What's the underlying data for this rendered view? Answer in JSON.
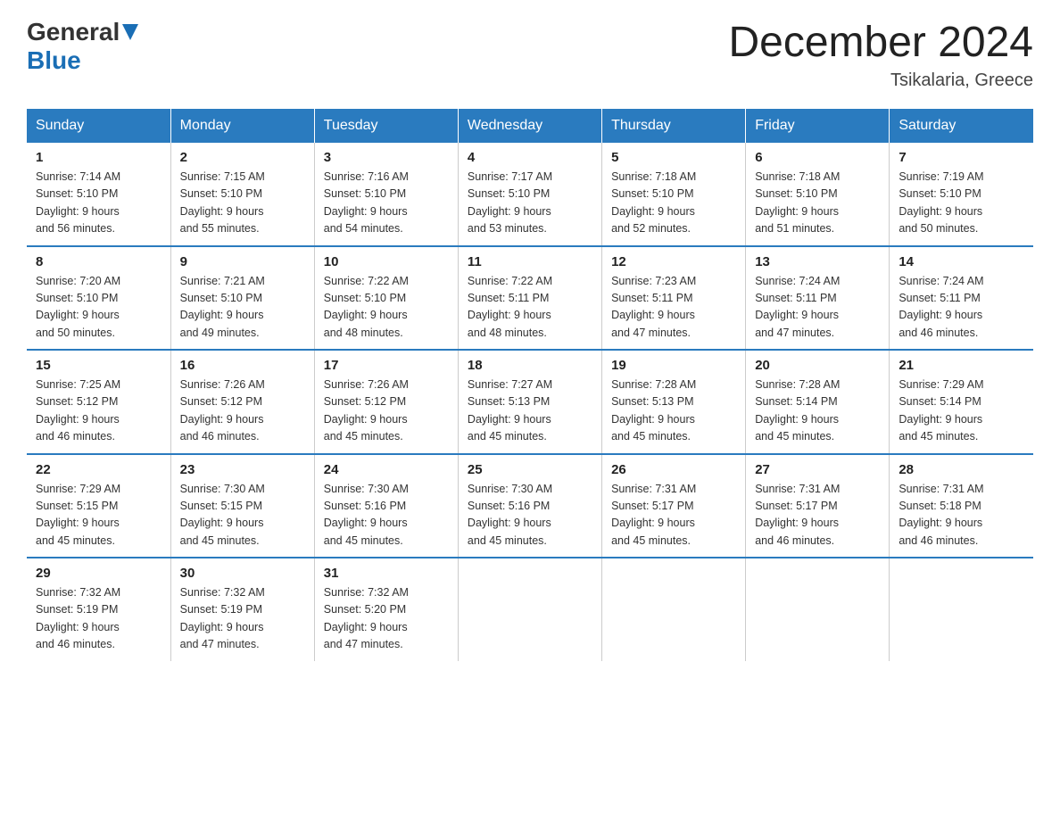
{
  "header": {
    "logo_general": "General",
    "logo_blue": "Blue",
    "month_title": "December 2024",
    "location": "Tsikalaria, Greece"
  },
  "columns": [
    "Sunday",
    "Monday",
    "Tuesday",
    "Wednesday",
    "Thursday",
    "Friday",
    "Saturday"
  ],
  "weeks": [
    [
      {
        "day": "1",
        "sunrise": "7:14 AM",
        "sunset": "5:10 PM",
        "daylight": "9 hours and 56 minutes."
      },
      {
        "day": "2",
        "sunrise": "7:15 AM",
        "sunset": "5:10 PM",
        "daylight": "9 hours and 55 minutes."
      },
      {
        "day": "3",
        "sunrise": "7:16 AM",
        "sunset": "5:10 PM",
        "daylight": "9 hours and 54 minutes."
      },
      {
        "day": "4",
        "sunrise": "7:17 AM",
        "sunset": "5:10 PM",
        "daylight": "9 hours and 53 minutes."
      },
      {
        "day": "5",
        "sunrise": "7:18 AM",
        "sunset": "5:10 PM",
        "daylight": "9 hours and 52 minutes."
      },
      {
        "day": "6",
        "sunrise": "7:18 AM",
        "sunset": "5:10 PM",
        "daylight": "9 hours and 51 minutes."
      },
      {
        "day": "7",
        "sunrise": "7:19 AM",
        "sunset": "5:10 PM",
        "daylight": "9 hours and 50 minutes."
      }
    ],
    [
      {
        "day": "8",
        "sunrise": "7:20 AM",
        "sunset": "5:10 PM",
        "daylight": "9 hours and 50 minutes."
      },
      {
        "day": "9",
        "sunrise": "7:21 AM",
        "sunset": "5:10 PM",
        "daylight": "9 hours and 49 minutes."
      },
      {
        "day": "10",
        "sunrise": "7:22 AM",
        "sunset": "5:10 PM",
        "daylight": "9 hours and 48 minutes."
      },
      {
        "day": "11",
        "sunrise": "7:22 AM",
        "sunset": "5:11 PM",
        "daylight": "9 hours and 48 minutes."
      },
      {
        "day": "12",
        "sunrise": "7:23 AM",
        "sunset": "5:11 PM",
        "daylight": "9 hours and 47 minutes."
      },
      {
        "day": "13",
        "sunrise": "7:24 AM",
        "sunset": "5:11 PM",
        "daylight": "9 hours and 47 minutes."
      },
      {
        "day": "14",
        "sunrise": "7:24 AM",
        "sunset": "5:11 PM",
        "daylight": "9 hours and 46 minutes."
      }
    ],
    [
      {
        "day": "15",
        "sunrise": "7:25 AM",
        "sunset": "5:12 PM",
        "daylight": "9 hours and 46 minutes."
      },
      {
        "day": "16",
        "sunrise": "7:26 AM",
        "sunset": "5:12 PM",
        "daylight": "9 hours and 46 minutes."
      },
      {
        "day": "17",
        "sunrise": "7:26 AM",
        "sunset": "5:12 PM",
        "daylight": "9 hours and 45 minutes."
      },
      {
        "day": "18",
        "sunrise": "7:27 AM",
        "sunset": "5:13 PM",
        "daylight": "9 hours and 45 minutes."
      },
      {
        "day": "19",
        "sunrise": "7:28 AM",
        "sunset": "5:13 PM",
        "daylight": "9 hours and 45 minutes."
      },
      {
        "day": "20",
        "sunrise": "7:28 AM",
        "sunset": "5:14 PM",
        "daylight": "9 hours and 45 minutes."
      },
      {
        "day": "21",
        "sunrise": "7:29 AM",
        "sunset": "5:14 PM",
        "daylight": "9 hours and 45 minutes."
      }
    ],
    [
      {
        "day": "22",
        "sunrise": "7:29 AM",
        "sunset": "5:15 PM",
        "daylight": "9 hours and 45 minutes."
      },
      {
        "day": "23",
        "sunrise": "7:30 AM",
        "sunset": "5:15 PM",
        "daylight": "9 hours and 45 minutes."
      },
      {
        "day": "24",
        "sunrise": "7:30 AM",
        "sunset": "5:16 PM",
        "daylight": "9 hours and 45 minutes."
      },
      {
        "day": "25",
        "sunrise": "7:30 AM",
        "sunset": "5:16 PM",
        "daylight": "9 hours and 45 minutes."
      },
      {
        "day": "26",
        "sunrise": "7:31 AM",
        "sunset": "5:17 PM",
        "daylight": "9 hours and 45 minutes."
      },
      {
        "day": "27",
        "sunrise": "7:31 AM",
        "sunset": "5:17 PM",
        "daylight": "9 hours and 46 minutes."
      },
      {
        "day": "28",
        "sunrise": "7:31 AM",
        "sunset": "5:18 PM",
        "daylight": "9 hours and 46 minutes."
      }
    ],
    [
      {
        "day": "29",
        "sunrise": "7:32 AM",
        "sunset": "5:19 PM",
        "daylight": "9 hours and 46 minutes."
      },
      {
        "day": "30",
        "sunrise": "7:32 AM",
        "sunset": "5:19 PM",
        "daylight": "9 hours and 47 minutes."
      },
      {
        "day": "31",
        "sunrise": "7:32 AM",
        "sunset": "5:20 PM",
        "daylight": "9 hours and 47 minutes."
      },
      null,
      null,
      null,
      null
    ]
  ],
  "labels": {
    "sunrise_prefix": "Sunrise: ",
    "sunset_prefix": "Sunset: ",
    "daylight_prefix": "Daylight: "
  }
}
